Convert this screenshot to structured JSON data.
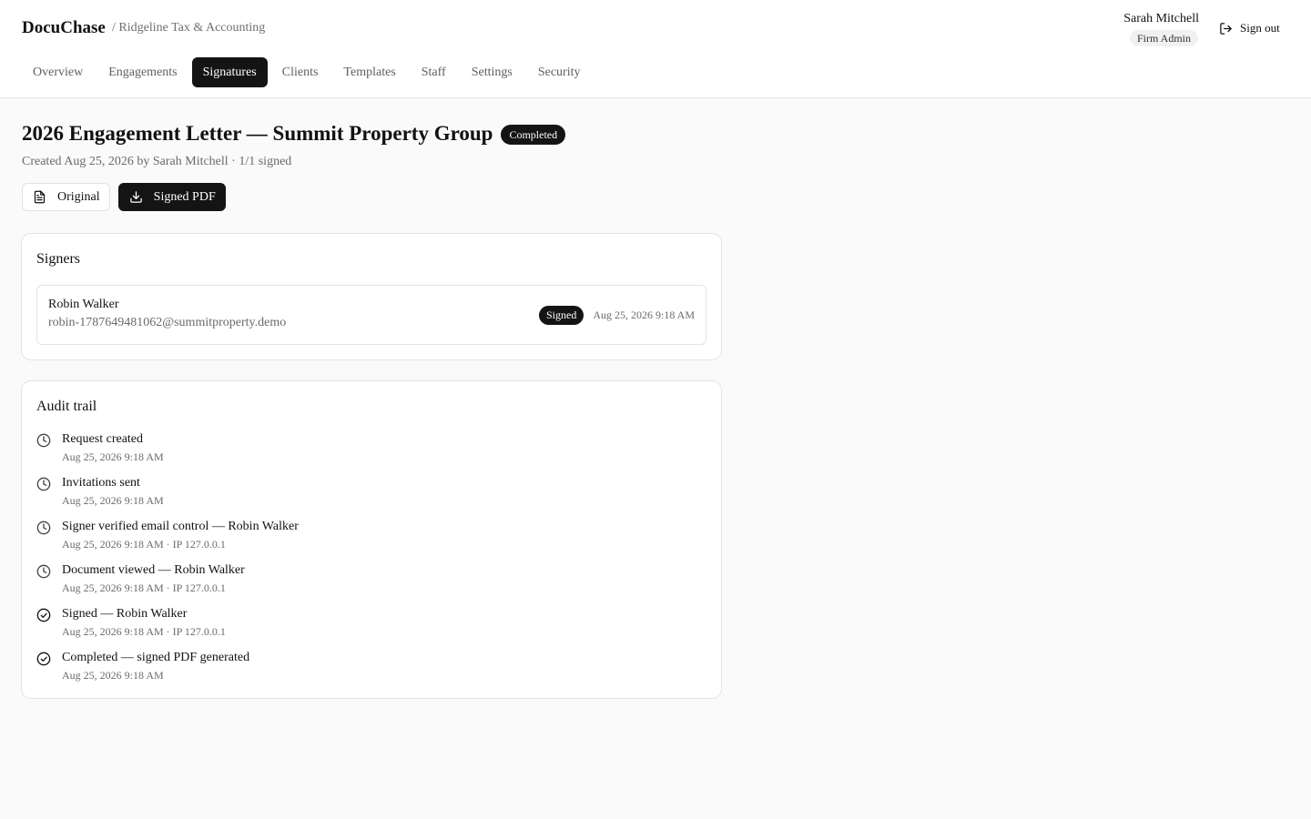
{
  "header": {
    "brand": "DocuChase",
    "org": "/ Ridgeline Tax & Accounting",
    "user_name": "Sarah Mitchell",
    "user_role": "Firm Admin",
    "signout_label": "Sign out",
    "signout_icon": "sign-out-icon"
  },
  "nav": {
    "tabs": [
      {
        "label": "Overview",
        "active": false
      },
      {
        "label": "Engagements",
        "active": false
      },
      {
        "label": "Signatures",
        "active": true
      },
      {
        "label": "Clients",
        "active": false
      },
      {
        "label": "Templates",
        "active": false
      },
      {
        "label": "Staff",
        "active": false
      },
      {
        "label": "Settings",
        "active": false
      },
      {
        "label": "Security",
        "active": false
      }
    ]
  },
  "document": {
    "title": "2026 Engagement Letter — Summit Property Group",
    "status": "Completed",
    "meta": "Created Aug 25, 2026 by Sarah Mitchell · 1/1 signed",
    "original_label": "Original",
    "original_icon": "document-icon",
    "signed_pdf_label": "Signed PDF",
    "signed_pdf_icon": "download-icon"
  },
  "signers": {
    "title": "Signers",
    "items": [
      {
        "name": "Robin Walker",
        "email": "robin-1787649481062@summitproperty.demo",
        "status": "Signed",
        "time": "Aug 25, 2026 9:18 AM"
      }
    ]
  },
  "audit": {
    "title": "Audit trail",
    "items": [
      {
        "event": "Request created",
        "detail": "Aug 25, 2026 9:18 AM",
        "icon": "clock-icon"
      },
      {
        "event": "Invitations sent",
        "detail": "Aug 25, 2026 9:18 AM",
        "icon": "clock-icon"
      },
      {
        "event": "Signer verified email control — Robin Walker",
        "detail": "Aug 25, 2026 9:18 AM · IP 127.0.0.1",
        "icon": "clock-icon"
      },
      {
        "event": "Document viewed — Robin Walker",
        "detail": "Aug 25, 2026 9:18 AM · IP 127.0.0.1",
        "icon": "clock-icon"
      },
      {
        "event": "Signed — Robin Walker",
        "detail": "Aug 25, 2026 9:18 AM · IP 127.0.0.1",
        "icon": "check-circle-icon"
      },
      {
        "event": "Completed — signed PDF generated",
        "detail": "Aug 25, 2026 9:18 AM",
        "icon": "check-circle-icon"
      }
    ]
  },
  "colors": {
    "accent": "#141414",
    "background": "#fafafa",
    "muted_text": "#6a6a6a"
  }
}
